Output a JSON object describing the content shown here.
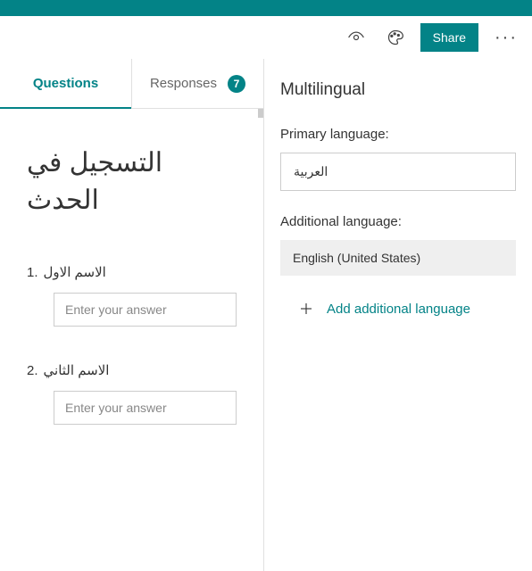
{
  "toolbar": {
    "share_label": "Share"
  },
  "tabs": {
    "questions_label": "Questions",
    "responses_label": "Responses",
    "responses_count": "7"
  },
  "form": {
    "title": "التسجيل في الحدث",
    "questions": [
      {
        "num": "1.",
        "label": "الاسم الاول",
        "placeholder": "Enter your answer"
      },
      {
        "num": "2.",
        "label": "الاسم الثاني",
        "placeholder": "Enter your answer"
      }
    ]
  },
  "panel": {
    "title": "Multilingual",
    "primary_label": "Primary language:",
    "primary_value": "العربية",
    "additional_label": "Additional language:",
    "additional_value": "English (United States)",
    "add_more_label": "Add additional language"
  }
}
